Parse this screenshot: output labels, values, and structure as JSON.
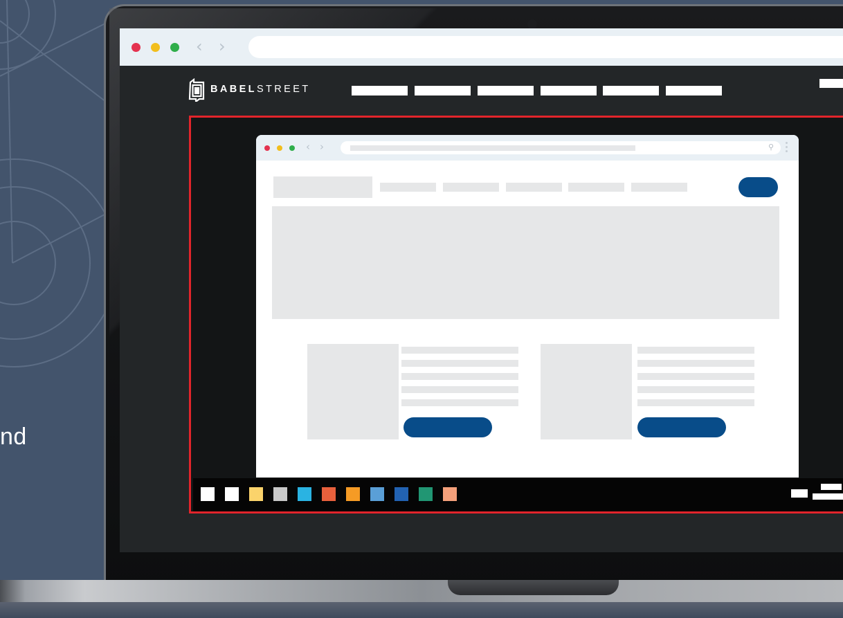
{
  "background": {
    "color": "#43546c",
    "side_text": "nd"
  },
  "outer_browser": {
    "window_controls": {
      "close_color": "#e4324f",
      "minimize_color": "#f2be1d",
      "maximize_color": "#2fae4a"
    },
    "nav": {
      "back_icon": "chevron-left-icon",
      "forward_icon": "chevron-right-icon"
    },
    "address_value": ""
  },
  "site_header": {
    "brand_bold": "BABEL",
    "brand_light": "STREET",
    "logo_icon": "babel-street-logo-icon",
    "nav_item_count_visible": 6
  },
  "highlight_frame": {
    "color": "#e2242b"
  },
  "inner_browser": {
    "window_controls": {
      "close_color": "#e4324f",
      "minimize_color": "#f2be1d",
      "maximize_color": "#2fae4a"
    },
    "search_icon": "search-icon",
    "menu_icon": "kebab-menu-icon",
    "accent_color": "#084c89",
    "placeholder_color": "#e6e7e8"
  },
  "palette": {
    "swatches": [
      "#ffffff",
      "#ffffff",
      "#fbd36b",
      "#c8c8c8",
      "#2ab3e2",
      "#e8603c",
      "#f59b25",
      "#5a9fd7",
      "#2262b2",
      "#219673",
      "#f4a07b"
    ]
  }
}
